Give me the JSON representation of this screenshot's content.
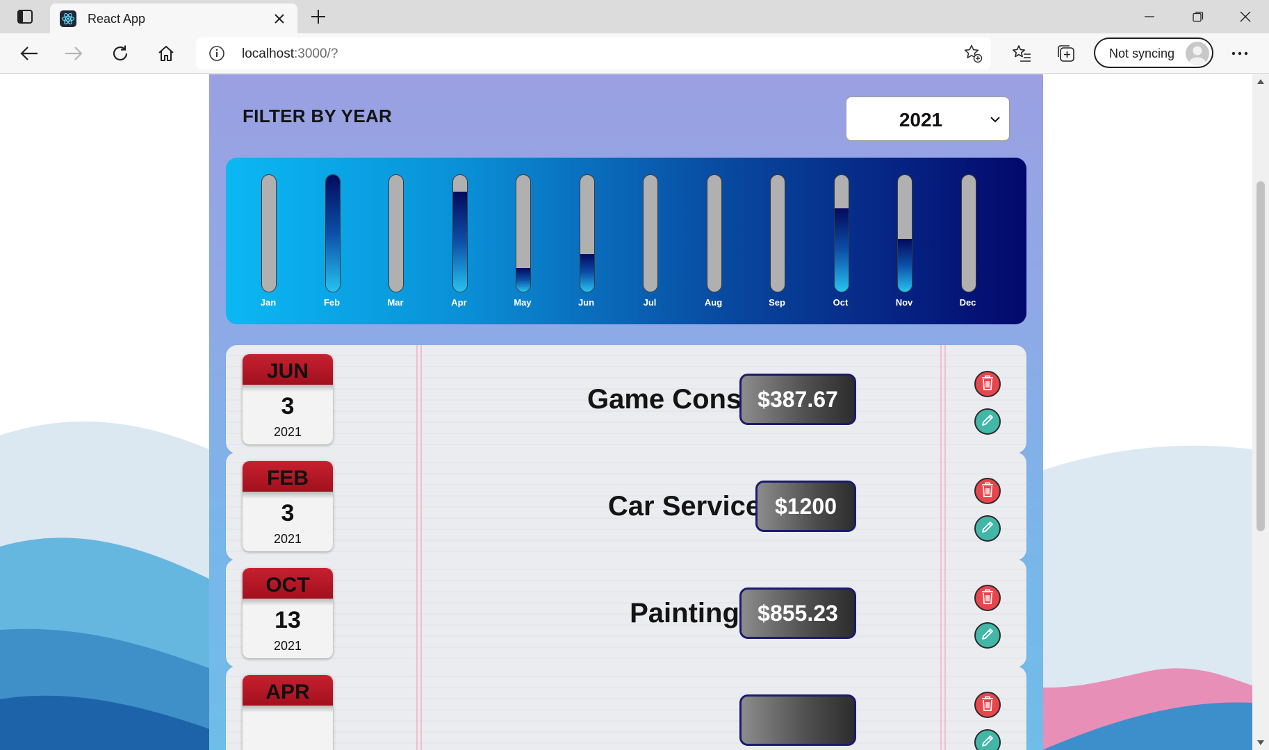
{
  "browser": {
    "tab_title": "React App",
    "url_host": "localhost",
    "url_path": ":3000/?",
    "sync_label": "Not syncing"
  },
  "filter": {
    "label": "FILTER BY YEAR",
    "selected_year": "2021"
  },
  "chart_data": {
    "type": "bar",
    "categories": [
      "Jan",
      "Feb",
      "Mar",
      "Apr",
      "May",
      "Jun",
      "Jul",
      "Aug",
      "Sep",
      "Oct",
      "Nov",
      "Dec"
    ],
    "values": [
      0,
      1200,
      0,
      1030,
      240,
      387.67,
      0,
      0,
      0,
      855.23,
      540,
      0
    ],
    "ylim": [
      0,
      1200
    ],
    "colors": {
      "track": "#b0b0b0",
      "fill_top": "#030a5c",
      "fill_bottom": "#27c2f0"
    }
  },
  "expenses": [
    {
      "month": "JUN",
      "day": "3",
      "year": "2021",
      "title": "Game Console",
      "amount": "$387.67"
    },
    {
      "month": "FEB",
      "day": "3",
      "year": "2021",
      "title": "Car Service",
      "amount": "$1200"
    },
    {
      "month": "OCT",
      "day": "13",
      "year": "2021",
      "title": "Painting",
      "amount": "$855.23"
    },
    {
      "month": "APR",
      "day": "",
      "year": "",
      "title": "",
      "amount": ""
    }
  ],
  "icons": {
    "delete": "trash-icon",
    "edit": "pencil-icon"
  },
  "colors": {
    "panel_top": "#9aa0e2",
    "panel_bottom": "#6fbde9",
    "month_banner": "#c7202f",
    "delete_button": "#e8454c",
    "edit_button": "#42b7a8",
    "price_border": "#1a1b6e"
  }
}
